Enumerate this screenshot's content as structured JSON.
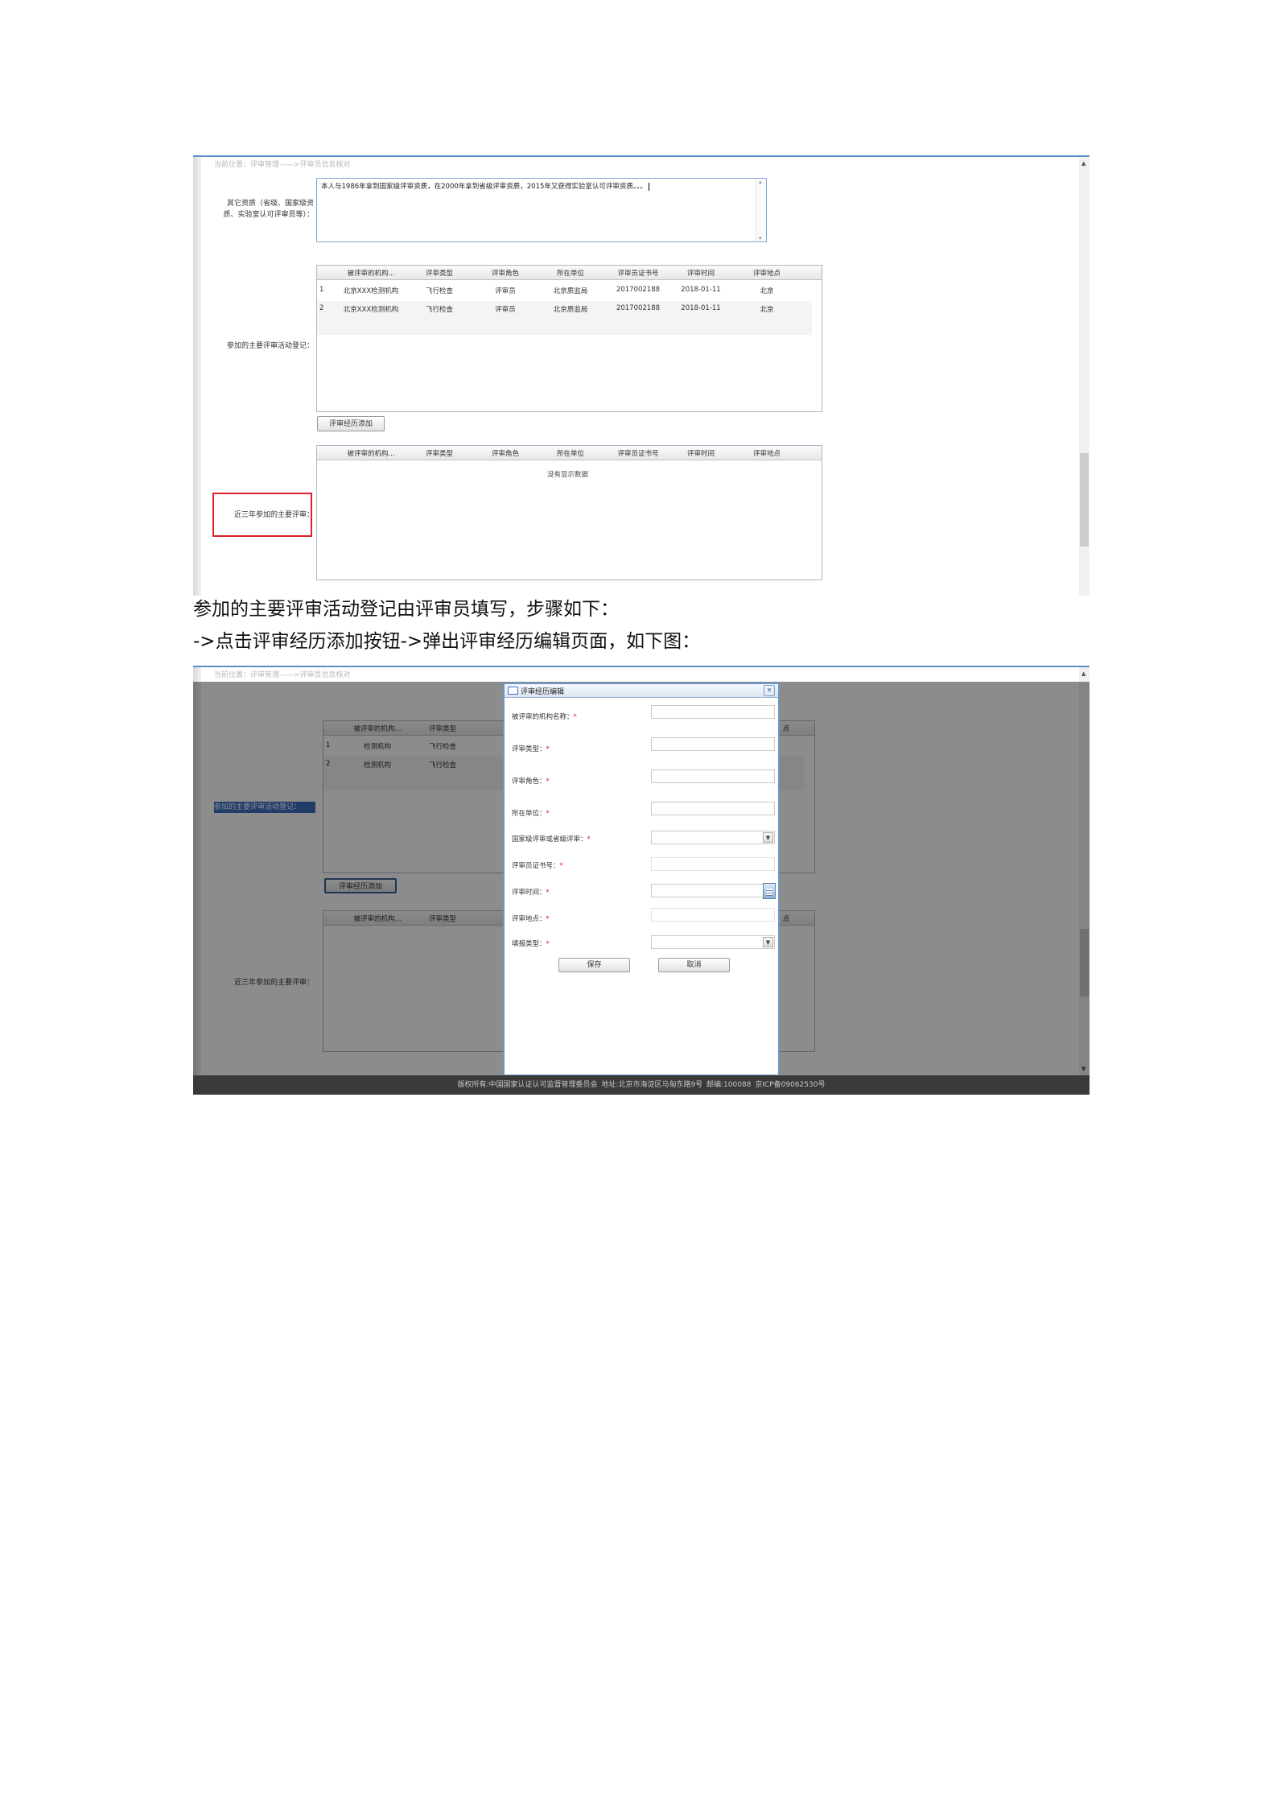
{
  "screenshot1": {
    "breadcrumb": "当前位置：评审管理——>评审员信息核对",
    "other_quals_label": [
      "其它资质（省级、国家级资",
      "质、实验室认可评审员等）："
    ],
    "other_quals_text": "本人与1986年拿到国家级评审资质，在2000年拿到省级评审资质，2015年又获得实验室认可评审资质。。。",
    "activity_label": "参加的主要评审活动登记：",
    "table_headers": [
      "被评审的机构...",
      "评审类型",
      "评审角色",
      "所在单位",
      "评审员证书号",
      "评审时间",
      "评审地点"
    ],
    "rows": [
      {
        "no": "1",
        "org": "北京XXX检测机构",
        "type": "飞行检查",
        "role": "评审员",
        "unit": "北京质监局",
        "cert": "2017002188",
        "date": "2018-01-11",
        "place": "北京"
      },
      {
        "no": "2",
        "org": "北京XXX检测机构",
        "type": "飞行检查",
        "role": "评审员",
        "unit": "北京质监局",
        "cert": "2017002188",
        "date": "2018-01-11",
        "place": "北京"
      }
    ],
    "add_button": "评审经历添加",
    "recent_label": "近三年参加的主要评审：",
    "empty_text": "没有显示数据"
  },
  "captions": [
    "参加的主要评审活动登记由评审员填写，步骤如下：",
    "->点击评审经历添加按钮->弹出评审经历编辑页面，如下图："
  ],
  "screenshot2": {
    "breadcrumb": "当前位置：评审管理——>评审员信息核对",
    "activity_label": "参加的主要评审活动登记：",
    "recent_label": "近三年参加的主要评审：",
    "visible_headers": [
      "被评审的机构...",
      "评审类型"
    ],
    "right_header_fragment": "点",
    "rows": [
      {
        "no": "1",
        "org": "检测机构",
        "type": "飞行检查"
      },
      {
        "no": "2",
        "org": "检测机构",
        "type": "飞行检查"
      }
    ],
    "add_button": "评审经历添加",
    "footer": "版权所有:中国国家认证认可监督管理委员会    地址:北京市海淀区马甸东路9号    邮编:100088    京ICP备09062530号",
    "dialog": {
      "title": "评审经历编辑",
      "fields": [
        {
          "label": "被评审的机构名称：",
          "kind": "text"
        },
        {
          "label": "评审类型：",
          "kind": "text"
        },
        {
          "label": "评审角色：",
          "kind": "text"
        },
        {
          "label": "所在单位：",
          "kind": "text"
        },
        {
          "label": "国家级评审或省级评审：",
          "kind": "select"
        },
        {
          "label": "评审员证书号：",
          "kind": "text"
        },
        {
          "label": "评审时间：",
          "kind": "date"
        },
        {
          "label": "评审地点：",
          "kind": "text"
        },
        {
          "label": "填报类型：",
          "kind": "select"
        }
      ],
      "required_mark": "*",
      "save_button": "保存",
      "cancel_button": "取消"
    }
  }
}
